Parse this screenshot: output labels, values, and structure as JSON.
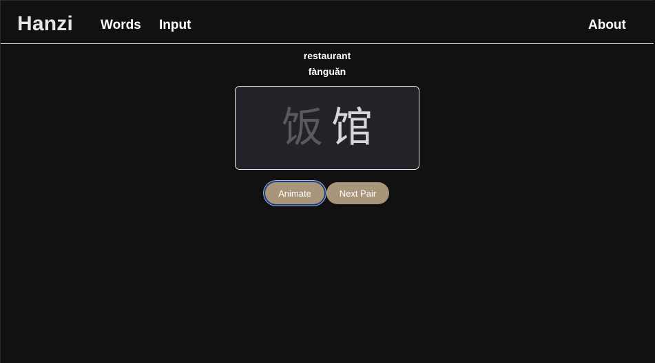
{
  "nav": {
    "brand": "Hanzi",
    "links": [
      "Words",
      "Input"
    ],
    "about": "About"
  },
  "word": {
    "meaning": "restaurant",
    "pinyin": "fànguǎn",
    "characters": [
      "饭",
      "馆"
    ]
  },
  "buttons": {
    "animate": "Animate",
    "next_pair": "Next Pair"
  },
  "colors": {
    "background": "#111111",
    "card_background": "#212328",
    "button": "#a8957a",
    "focus_ring": "#9fb6e6"
  }
}
